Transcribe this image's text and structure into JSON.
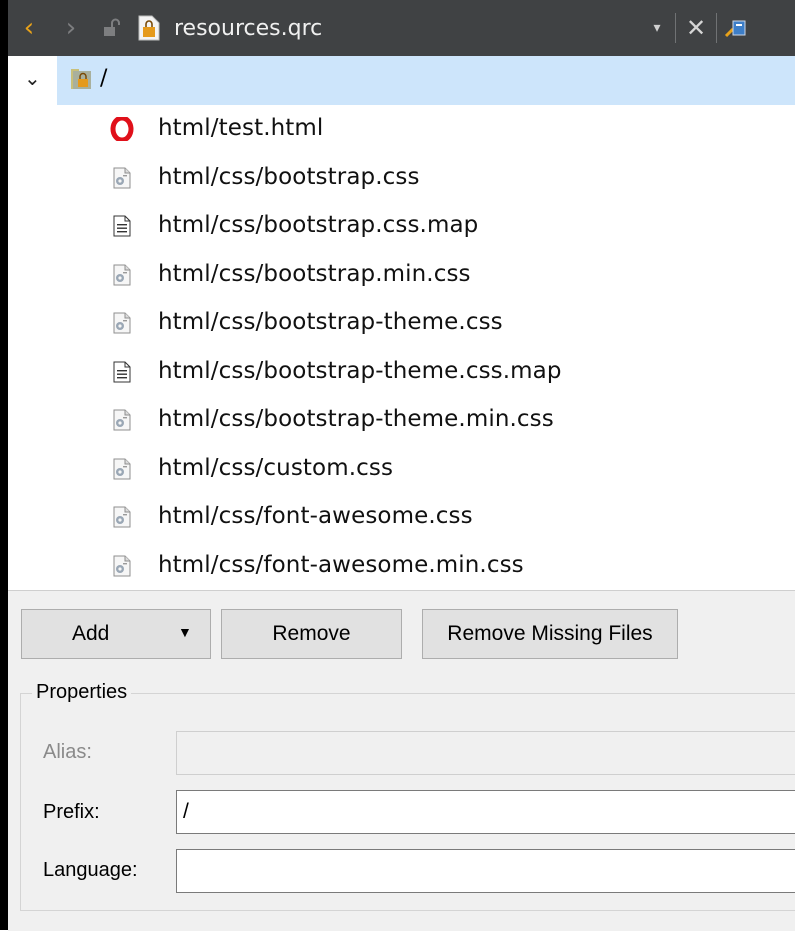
{
  "titlebar": {
    "title": "resources.qrc",
    "back_icon": "chevron-left-icon",
    "forward_icon": "chevron-right-icon",
    "dropdown_glyph": "▾",
    "close_glyph": "✕"
  },
  "tree": {
    "root": {
      "label": "/",
      "expanded": true,
      "selected": true
    },
    "items": [
      {
        "label": "html/test.html",
        "icon": "opera-browser-icon"
      },
      {
        "label": "html/css/bootstrap.css",
        "icon": "css-file-icon"
      },
      {
        "label": "html/css/bootstrap.css.map",
        "icon": "text-file-icon"
      },
      {
        "label": "html/css/bootstrap.min.css",
        "icon": "css-file-icon"
      },
      {
        "label": "html/css/bootstrap-theme.css",
        "icon": "css-file-icon"
      },
      {
        "label": "html/css/bootstrap-theme.css.map",
        "icon": "text-file-icon"
      },
      {
        "label": "html/css/bootstrap-theme.min.css",
        "icon": "css-file-icon"
      },
      {
        "label": "html/css/custom.css",
        "icon": "css-file-icon"
      },
      {
        "label": "html/css/font-awesome.css",
        "icon": "css-file-icon"
      },
      {
        "label": "html/css/font-awesome.min.css",
        "icon": "css-file-icon"
      }
    ]
  },
  "buttons": {
    "add": "Add",
    "remove": "Remove",
    "remove_missing": "Remove Missing Files"
  },
  "properties": {
    "legend": "Properties",
    "alias_label": "Alias:",
    "alias_value": "",
    "prefix_label": "Prefix:",
    "prefix_value": "/",
    "language_label": "Language:",
    "language_value": ""
  },
  "colors": {
    "titlebar_bg": "#404244",
    "selection_bg": "#cde5fb",
    "back_arrow": "#e8a21a",
    "opera_red": "#e0101a"
  }
}
